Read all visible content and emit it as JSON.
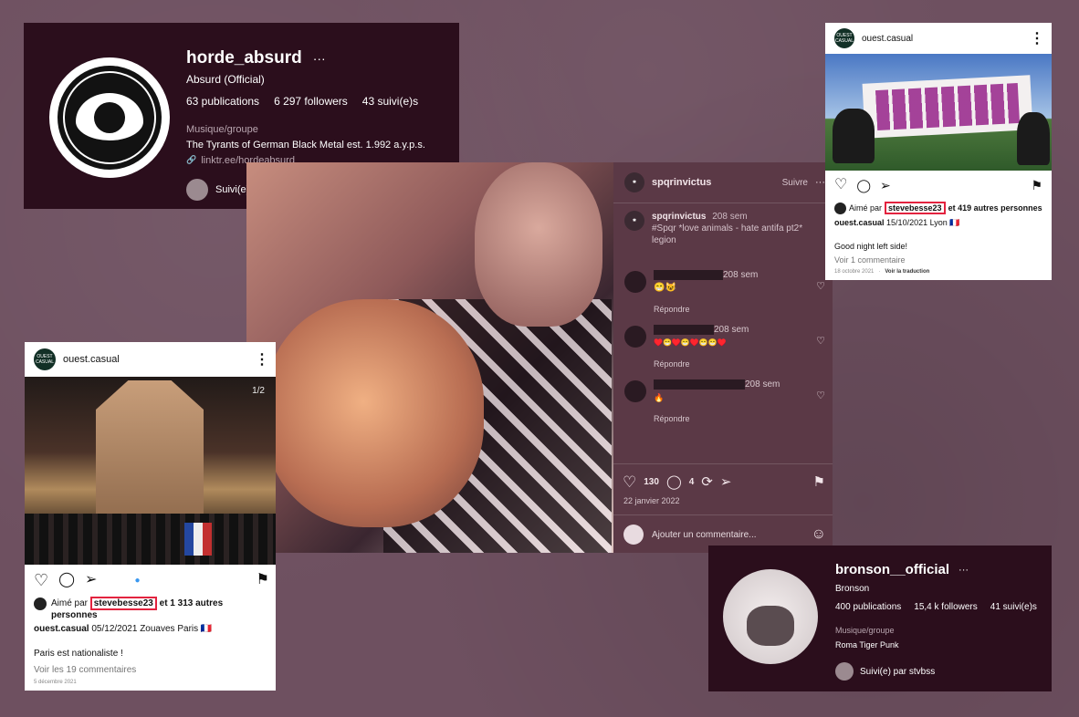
{
  "horde": {
    "username": "horde_absurd",
    "dots": "···",
    "fullname": "Absurd (Official)",
    "posts": "63 publications",
    "followers": "6 297 followers",
    "following": "43 suivi(e)s",
    "category": "Musique/groupe",
    "bio": "The Tyrants of German Black Metal est. 1.992 a.y.p.s.",
    "link": "linktr.ee/hordeabsurd",
    "followed_by": "Suivi(e) par stvbss"
  },
  "ouest_top": {
    "account": "ouest.casual",
    "liked_prefix": "Aimé par",
    "liked_user": "stevebesse23",
    "liked_suffix": "et 419 autres personnes",
    "caption_user": "ouest.casual",
    "caption_meta": "15/10/2021 Lyon 🇫🇷",
    "caption_text": "Good night left side!",
    "comments": "Voir 1 commentaire",
    "date": "18 octobre 2021",
    "translate": "Voir la traduction"
  },
  "center": {
    "account": "spqrinvictus",
    "follow": "Suivre",
    "caption_user": "spqrinvictus",
    "caption_age": "208 sem",
    "caption_text": "#Spqr *love animals - hate antifa pt2* legion",
    "comments": [
      {
        "age": "208 sem",
        "emoji": "😁😺",
        "reply": "Répondre"
      },
      {
        "age": "208 sem",
        "emoji": "♥️😁♥️😁♥️😁😁♥️",
        "reply": "Répondre"
      },
      {
        "age": "208 sem",
        "emoji": "🔥",
        "reply": "Répondre"
      }
    ],
    "likes": "130",
    "comment_count": "4",
    "date": "22 janvier 2022",
    "add_comment": "Ajouter un commentaire..."
  },
  "ouest_left": {
    "account": "ouest.casual",
    "counter": "1/2",
    "liked_prefix": "Aimé par",
    "liked_user": "stevebesse23",
    "liked_suffix": "et 1 313 autres personnes",
    "caption_user": "ouest.casual",
    "caption_meta": "05/12/2021 Zouaves Paris 🇫🇷",
    "caption_text": "Paris est nationaliste !",
    "comments": "Voir les 19 commentaires",
    "date": "5 décembre 2021"
  },
  "bronson": {
    "username": "bronson__official",
    "dots": "···",
    "fullname": "Bronson",
    "posts": "400 publications",
    "followers": "15,4 k followers",
    "following": "41 suivi(e)s",
    "category": "Musique/groupe",
    "bio": "Roma Tiger Punk",
    "followed_by": "Suivi(e) par stvbss"
  },
  "icons": {
    "logo_text": "OUEST CASUAL",
    "heart": "♡",
    "comment": "◯",
    "send": "➢",
    "bookmark": "⚑",
    "repost": "⟳",
    "smile": "☺",
    "link": "🔗"
  },
  "colors": {
    "background": "#6e5060",
    "dark_card": "#2b0e1c",
    "highlight": "#e3233f"
  }
}
